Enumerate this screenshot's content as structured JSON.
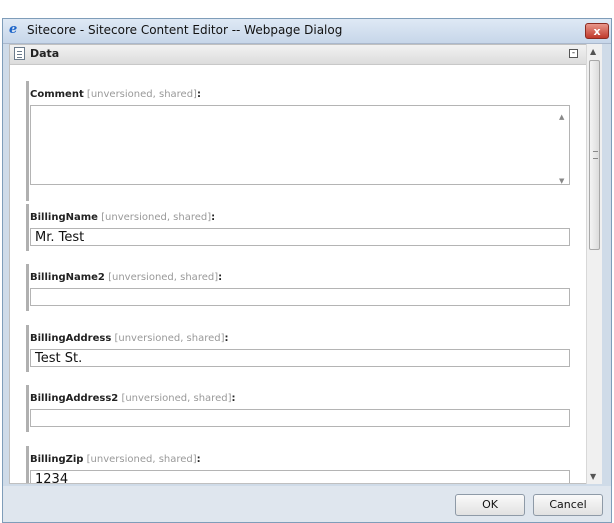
{
  "window": {
    "title": "Sitecore - Sitecore Content Editor -- Webpage Dialog",
    "close_label": "x"
  },
  "section": {
    "title": "Data",
    "collapse_label": "-"
  },
  "fields": [
    {
      "name": "Comment",
      "meta": "[unversioned, shared]",
      "colon": ":",
      "type": "textarea",
      "value": ""
    },
    {
      "name": "BillingName",
      "meta": "[unversioned, shared]",
      "colon": ":",
      "type": "text",
      "value": "Mr. Test"
    },
    {
      "name": "BillingName2",
      "meta": "[unversioned, shared]",
      "colon": ":",
      "type": "text",
      "value": ""
    },
    {
      "name": "BillingAddress",
      "meta": "[unversioned, shared]",
      "colon": ":",
      "type": "text",
      "value": "Test St."
    },
    {
      "name": "BillingAddress2",
      "meta": "[unversioned, shared]",
      "colon": ":",
      "type": "text",
      "value": ""
    },
    {
      "name": "BillingZip",
      "meta": "[unversioned, shared]",
      "colon": ":",
      "type": "text",
      "value": "1234"
    }
  ],
  "buttons": {
    "ok": "OK",
    "cancel": "Cancel"
  },
  "icons": {
    "app": "ie-icon",
    "section": "document-icon",
    "status": "green-status-icon"
  },
  "colors": {
    "title_bar": "#c7d6e9",
    "close_button": "#c0392b",
    "meta_text": "#999999",
    "field_bar": "#b0b0b0",
    "status_green": "#2ea82e"
  }
}
